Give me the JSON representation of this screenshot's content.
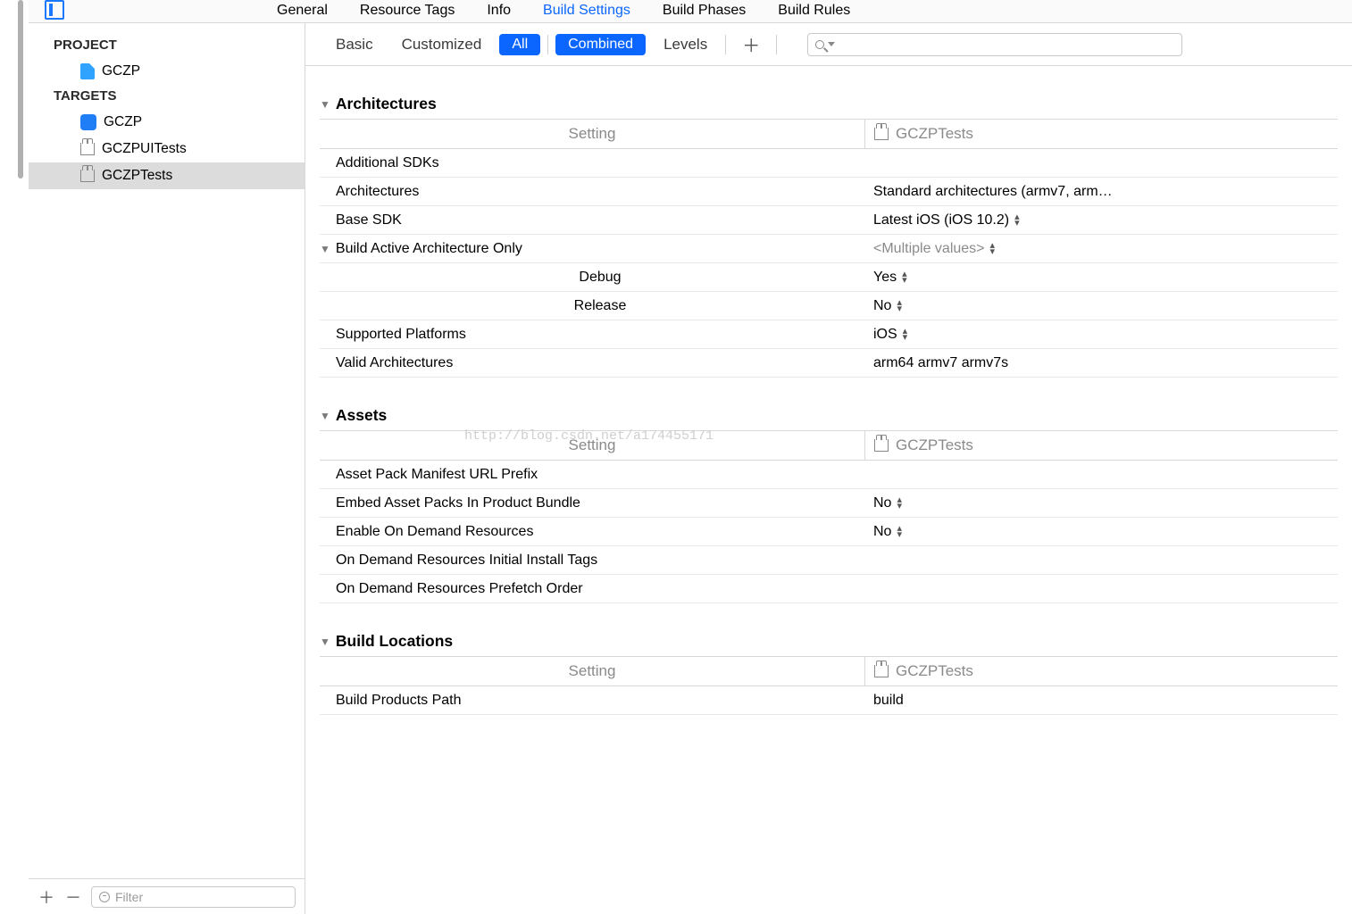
{
  "topTabs": {
    "general": "General",
    "resourceTags": "Resource Tags",
    "info": "Info",
    "buildSettings": "Build Settings",
    "buildPhases": "Build Phases",
    "buildRules": "Build Rules"
  },
  "sidebar": {
    "projectHeader": "PROJECT",
    "projectName": "GCZP",
    "targetsHeader": "TARGETS",
    "targets": {
      "app": "GCZP",
      "uitests": "GCZPUITests",
      "tests": "GCZPTests"
    },
    "filterPlaceholder": "Filter"
  },
  "toolbar": {
    "basic": "Basic",
    "customized": "Customized",
    "all": "All",
    "combined": "Combined",
    "levels": "Levels"
  },
  "columnTarget": "GCZPTests",
  "settingLabel": "Setting",
  "groups": {
    "architectures": {
      "title": "Architectures",
      "rows": {
        "additionalSDKs": {
          "k": "Additional SDKs",
          "v": ""
        },
        "architectures": {
          "k": "Architectures",
          "v": "Standard architectures (armv7, arm…"
        },
        "baseSDK": {
          "k": "Base SDK",
          "v": "Latest iOS (iOS 10.2)"
        },
        "buildActive": {
          "k": "Build Active Architecture Only",
          "v": "<Multiple values>"
        },
        "debug": {
          "k": "Debug",
          "v": "Yes"
        },
        "release": {
          "k": "Release",
          "v": "No"
        },
        "supported": {
          "k": "Supported Platforms",
          "v": "iOS"
        },
        "valid": {
          "k": "Valid Architectures",
          "v": "arm64 armv7 armv7s"
        }
      }
    },
    "assets": {
      "title": "Assets",
      "rows": {
        "manifestURL": {
          "k": "Asset Pack Manifest URL Prefix",
          "v": ""
        },
        "embedProduct": {
          "k": "Embed Asset Packs In Product Bundle",
          "v": "No"
        },
        "enableODR": {
          "k": "Enable On Demand Resources",
          "v": "No"
        },
        "initialTags": {
          "k": "On Demand Resources Initial Install Tags",
          "v": ""
        },
        "prefetch": {
          "k": "On Demand Resources Prefetch Order",
          "v": ""
        }
      }
    },
    "buildLocations": {
      "title": "Build Locations",
      "rows": {
        "productsPath": {
          "k": "Build Products Path",
          "v": "build"
        }
      }
    }
  },
  "watermark": "http://blog.csdn.net/a174455171"
}
